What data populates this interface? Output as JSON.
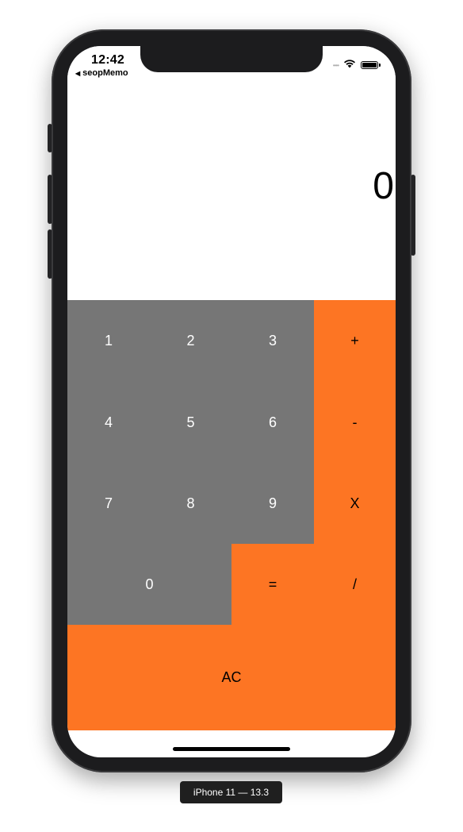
{
  "status_bar": {
    "time": "12:42",
    "back_app": "seopMemo",
    "back_arrow_icon": "back-triangle-icon",
    "wifi_icon": "wifi-icon",
    "battery_icon": "battery-icon"
  },
  "display": {
    "value": "0"
  },
  "keys": {
    "k1": "1",
    "k2": "2",
    "k3": "3",
    "plus": "+",
    "k4": "4",
    "k5": "5",
    "k6": "6",
    "minus": "-",
    "k7": "7",
    "k8": "8",
    "k9": "9",
    "multiply": "X",
    "k0": "0",
    "equals": "=",
    "divide": "/",
    "clear": "AC"
  },
  "colors": {
    "number_key": "#767676",
    "operator_key": "#fd7523",
    "screen_background": "#ffffff",
    "device_frame": "#1c1c1e"
  },
  "simulator_label": "iPhone 11 — 13.3"
}
